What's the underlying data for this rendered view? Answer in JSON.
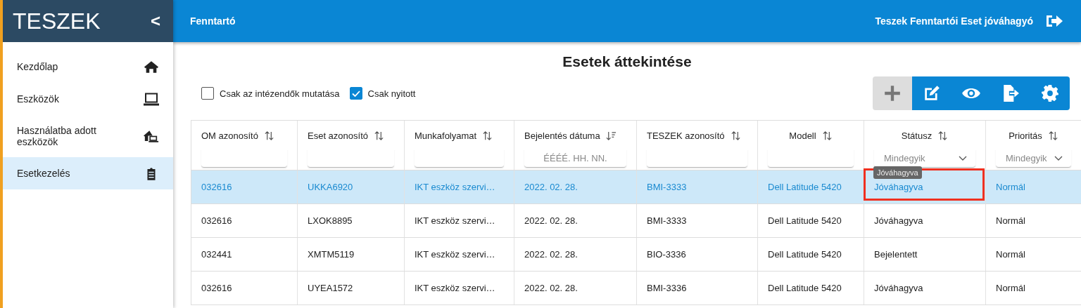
{
  "sidebar": {
    "logo": "TESZEK",
    "collapse": "<",
    "items": [
      {
        "label": "Kezdőlap",
        "selected": false
      },
      {
        "label": "Eszközök",
        "selected": false
      },
      {
        "label": "Használatba adott eszközök",
        "selected": false
      },
      {
        "label": "Esetkezelés",
        "selected": true
      }
    ]
  },
  "topbar": {
    "title": "Fenntartó",
    "user": "Teszek Fenntartói Eset jóváhagyó"
  },
  "page_title": "Esetek áttekintése",
  "filters": [
    {
      "label": "Csak az intézendők mutatása",
      "checked": false
    },
    {
      "label": "Csak nyitott",
      "checked": true
    }
  ],
  "toolbar": [
    {
      "disabled": true
    },
    {
      "disabled": false
    },
    {
      "disabled": false
    },
    {
      "disabled": false
    },
    {
      "disabled": false
    }
  ],
  "table": {
    "columns": [
      {
        "label": "OM azonosító",
        "sorted": false,
        "filter": {
          "kind": "input"
        }
      },
      {
        "label": "Eset azonosító",
        "sorted": false,
        "filter": {
          "kind": "input"
        }
      },
      {
        "label": "Munkafolyamat",
        "sorted": false,
        "filter": {
          "kind": "input"
        }
      },
      {
        "label": "Bejelentés dátuma",
        "sorted": true,
        "filter": {
          "kind": "input",
          "placeholder": "ÉÉÉÉ. HH. NN."
        }
      },
      {
        "label": "TESZEK azonosító",
        "sorted": false,
        "filter": {
          "kind": "input"
        }
      },
      {
        "label": "Modell",
        "sorted": false,
        "filter": {
          "kind": "input"
        }
      },
      {
        "label": "Státusz",
        "sorted": false,
        "filter": {
          "kind": "select",
          "value": "Mindegyik"
        }
      },
      {
        "label": "Prioritás",
        "sorted": false,
        "filter": {
          "kind": "select",
          "value": "Mindegyik"
        }
      }
    ],
    "rows": [
      {
        "selected": true,
        "cells": [
          "032616",
          "UKKA6920",
          "IKT eszköz szervi…",
          "2022. 02. 28.",
          "BMI-3333",
          "Dell Latitude 5420",
          "Jóváhagyva",
          "Normál"
        ]
      },
      {
        "selected": false,
        "cells": [
          "032616",
          "LXOK8895",
          "IKT eszköz szervi…",
          "2022. 02. 28.",
          "BMI-3333",
          "Dell Latitude 5420",
          "Jóváhagyva",
          "Normál"
        ]
      },
      {
        "selected": false,
        "cells": [
          "032441",
          "XMTM5119",
          "IKT eszköz szervi…",
          "2022. 02. 28.",
          "BIO-3336",
          "Dell Latitude 5420",
          "Bejelentett",
          "Normál"
        ]
      },
      {
        "selected": false,
        "cells": [
          "032616",
          "UYEA1572",
          "IKT eszköz szervi…",
          "2022. 02. 28.",
          "BMI-3336",
          "Dell Latitude 5420",
          "Jóváhagyva",
          "Normál"
        ]
      }
    ]
  },
  "cell_tooltip": "Jóváhagyva"
}
